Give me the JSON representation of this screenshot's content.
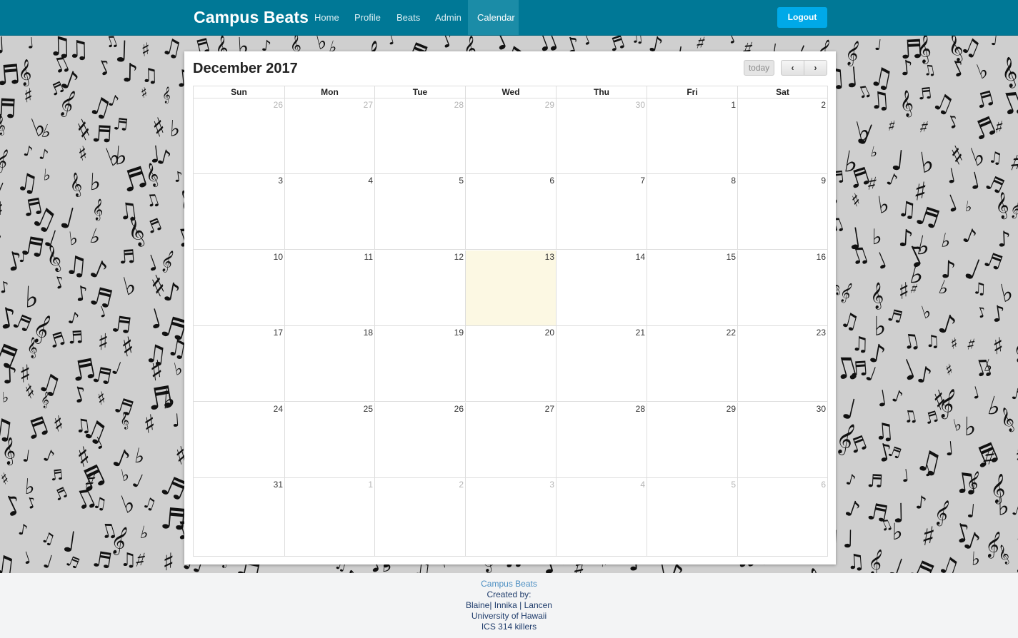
{
  "navbar": {
    "brand": "Campus Beats",
    "links": [
      "Home",
      "Profile",
      "Beats",
      "Admin",
      "Calendar"
    ],
    "active_link": "Calendar",
    "logout_label": "Logout"
  },
  "calendar": {
    "title": "December 2017",
    "today_label": "today",
    "prev_icon": "chevron-left-icon",
    "next_icon": "chevron-right-icon",
    "prev_glyph": "‹",
    "next_glyph": "›",
    "day_headers": [
      "Sun",
      "Mon",
      "Tue",
      "Wed",
      "Thu",
      "Fri",
      "Sat"
    ],
    "today_highlight_color": "#fcf8e3",
    "weeks": [
      [
        {
          "n": "26",
          "other": true
        },
        {
          "n": "27",
          "other": true
        },
        {
          "n": "28",
          "other": true
        },
        {
          "n": "29",
          "other": true
        },
        {
          "n": "30",
          "other": true
        },
        {
          "n": "1"
        },
        {
          "n": "2"
        }
      ],
      [
        {
          "n": "3"
        },
        {
          "n": "4"
        },
        {
          "n": "5"
        },
        {
          "n": "6"
        },
        {
          "n": "7"
        },
        {
          "n": "8"
        },
        {
          "n": "9"
        }
      ],
      [
        {
          "n": "10"
        },
        {
          "n": "11"
        },
        {
          "n": "12"
        },
        {
          "n": "13",
          "today": true
        },
        {
          "n": "14"
        },
        {
          "n": "15"
        },
        {
          "n": "16"
        }
      ],
      [
        {
          "n": "17"
        },
        {
          "n": "18"
        },
        {
          "n": "19"
        },
        {
          "n": "20"
        },
        {
          "n": "21"
        },
        {
          "n": "22"
        },
        {
          "n": "23"
        }
      ],
      [
        {
          "n": "24"
        },
        {
          "n": "25"
        },
        {
          "n": "26"
        },
        {
          "n": "27"
        },
        {
          "n": "28"
        },
        {
          "n": "29"
        },
        {
          "n": "30"
        }
      ],
      [
        {
          "n": "31"
        },
        {
          "n": "1",
          "other": true
        },
        {
          "n": "2",
          "other": true
        },
        {
          "n": "3",
          "other": true
        },
        {
          "n": "4",
          "other": true
        },
        {
          "n": "5",
          "other": true
        },
        {
          "n": "6",
          "other": true
        }
      ]
    ]
  },
  "footer": {
    "brand": "Campus Beats",
    "created_by": "Created by:",
    "authors": "Blaine| Innika | Lancen",
    "university": "University of Hawaii",
    "course": "ICS 314 killers"
  },
  "colors": {
    "navbar": "#007896",
    "navbar_active": "#1b8ca7",
    "logout_button": "#00a9e8",
    "background": "#cfcfcf"
  }
}
